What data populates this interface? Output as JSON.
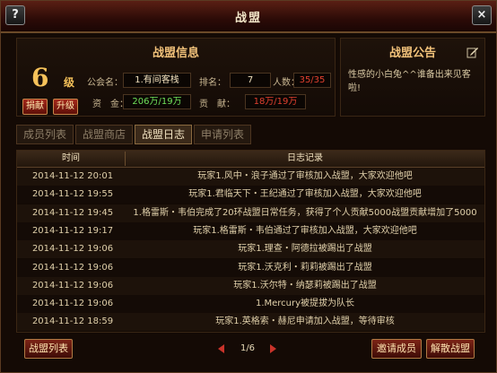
{
  "window": {
    "title": "战盟",
    "help_label": "?",
    "close_label": "×"
  },
  "info": {
    "title": "战盟信息",
    "level_value": "6",
    "level_unit": "级",
    "donate_label": "捐献",
    "upgrade_label": "升级",
    "guild_name_label": "公会名：",
    "guild_name_value": "1.有间客栈",
    "rank_label": "排名：",
    "rank_value": "7",
    "members_label": "人数：",
    "members_value": "35/35",
    "funds_label": "资　金：",
    "funds_value": "206万/19万",
    "contribution_label": "贡　献：",
    "contribution_value": "18万/19万",
    "colors": {
      "level": "#f6c25a",
      "funds": "#6fe05a",
      "red_value": "#e0402f",
      "normal_value": "#f0e0bd"
    }
  },
  "notice": {
    "title": "战盟公告",
    "text": "性感的小白兔^^谁备出来见客啦!",
    "edit_icon": "pencil-icon"
  },
  "tabs": [
    {
      "label": "成员列表",
      "active": false
    },
    {
      "label": "战盟商店",
      "active": false
    },
    {
      "label": "战盟日志",
      "active": true
    },
    {
      "label": "申请列表",
      "active": false
    }
  ],
  "log_table": {
    "columns": [
      "时间",
      "日志记录"
    ],
    "rows": [
      {
        "time": "2014-11-12 20:01",
        "text": "玩家1.风中・浪子通过了审核加入战盟，大家欢迎他吧"
      },
      {
        "time": "2014-11-12 19:55",
        "text": "玩家1.君临天下・王纪通过了审核加入战盟，大家欢迎他吧"
      },
      {
        "time": "2014-11-12 19:45",
        "text": "1.格雷斯・韦伯完成了20环战盟日常任务，获得了个人贡献5000战盟贡献增加了5000"
      },
      {
        "time": "2014-11-12 19:17",
        "text": "玩家1.格雷斯・韦伯通过了审核加入战盟，大家欢迎他吧"
      },
      {
        "time": "2014-11-12 19:06",
        "text": "玩家1.理查・阿德拉被踢出了战盟"
      },
      {
        "time": "2014-11-12 19:06",
        "text": "玩家1.沃克利・莉莉被踢出了战盟"
      },
      {
        "time": "2014-11-12 19:06",
        "text": "玩家1.沃尔特・纳瑟莉被踢出了战盟"
      },
      {
        "time": "2014-11-12 19:06",
        "text": "1.Mercury被提拔为队长"
      },
      {
        "time": "2014-11-12 18:59",
        "text": "玩家1.英格索・赫尼申请加入战盟，等待审核"
      }
    ]
  },
  "footer": {
    "list_button": "战盟列表",
    "page_text": "1/6",
    "invite_button": "邀请成员",
    "disband_button": "解散战盟"
  }
}
